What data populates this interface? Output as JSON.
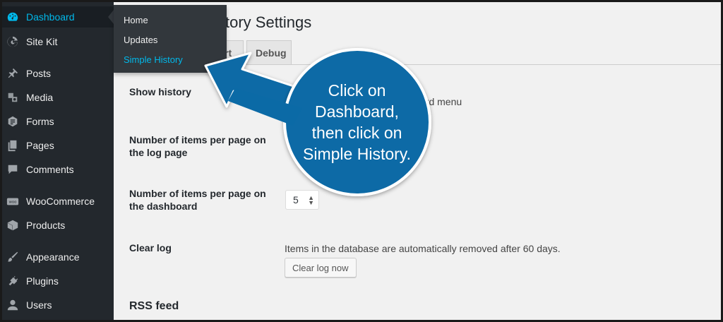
{
  "sidebar": {
    "items": [
      {
        "label": "Dashboard",
        "icon": "dashboard-icon"
      },
      {
        "label": "Site Kit",
        "icon": "google-g-icon"
      },
      {
        "label": "Posts",
        "icon": "pushpin-icon"
      },
      {
        "label": "Media",
        "icon": "media-icon"
      },
      {
        "label": "Forms",
        "icon": "forms-icon"
      },
      {
        "label": "Pages",
        "icon": "pages-icon"
      },
      {
        "label": "Comments",
        "icon": "comment-icon"
      },
      {
        "label": "WooCommerce",
        "icon": "woo-icon"
      },
      {
        "label": "Products",
        "icon": "box-icon"
      },
      {
        "label": "Appearance",
        "icon": "paintbrush-icon"
      },
      {
        "label": "Plugins",
        "icon": "plug-icon"
      },
      {
        "label": "Users",
        "icon": "user-icon"
      }
    ]
  },
  "flyout": {
    "items": [
      {
        "label": "Home"
      },
      {
        "label": "Updates"
      },
      {
        "label": "Simple History"
      }
    ]
  },
  "main": {
    "title_visible": "tory Settings",
    "tabs": [
      {
        "label": "rt"
      },
      {
        "label": "Debug"
      }
    ],
    "show_history_label": "Show history",
    "show_history_text": "ard menu",
    "items_per_page_log_label": "Number of items per page on the log page",
    "items_per_page_dashboard_label": "Number of items per page on the dashboard",
    "items_per_page_dashboard_value": "5",
    "clear_log_label": "Clear log",
    "clear_log_text": "Items in the database are automatically removed after 60 days.",
    "clear_log_button": "Clear log now",
    "rss_heading": "RSS feed"
  },
  "callout": {
    "text_lines": [
      "Click on",
      "Dashboard,",
      "then click on",
      "Simple History."
    ],
    "color": "#0b6aa6"
  },
  "colors": {
    "sidebar_bg": "#23282d",
    "accent": "#00b9eb",
    "active_bg": "#0073aa"
  }
}
